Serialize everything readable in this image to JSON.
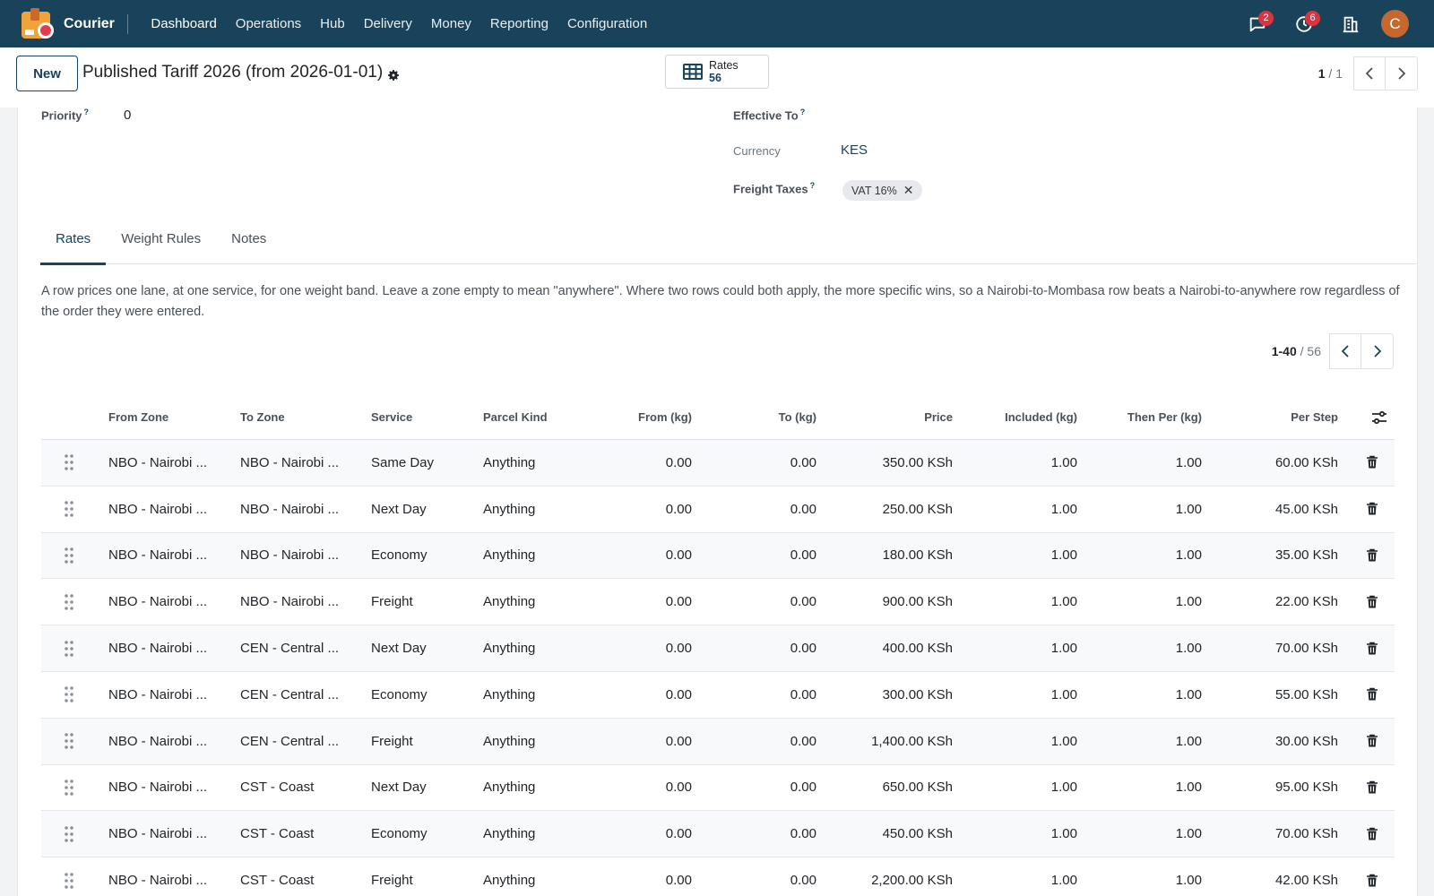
{
  "navbar": {
    "brand": "Courier",
    "menu": [
      "Dashboard",
      "Operations",
      "Hub",
      "Delivery",
      "Money",
      "Reporting",
      "Configuration"
    ],
    "messages_badge": "2",
    "activities_badge": "6",
    "avatar_initial": "C",
    "avatar_color": "#c6672d",
    "bar_color": "#18435a"
  },
  "control": {
    "new_label": "New",
    "title": "Published Tariff 2026 (from 2026-01-01)",
    "smart_button": {
      "label": "Rates",
      "count": "56",
      "icon": "table-icon"
    },
    "pager": {
      "current": "1",
      "total": "/ 1"
    }
  },
  "fields": {
    "priority": {
      "label": "Priority",
      "help": "?",
      "value": "0"
    },
    "effective_to": {
      "label": "Effective To",
      "help": "?"
    },
    "currency": {
      "label": "Currency",
      "value": "KES"
    },
    "freight_taxes": {
      "label": "Freight Taxes",
      "help": "?",
      "tag": "VAT 16%"
    }
  },
  "tabs": [
    "Rates",
    "Weight Rules",
    "Notes"
  ],
  "helptext": "A row prices one lane, at one service, for one weight band. Leave a zone empty to mean \"anywhere\". Where two rows could both apply, the more specific wins, so a Nairobi-to-Mombasa row beats a Nairobi-to-anywhere row regardless of the order they were entered.",
  "list_pager": {
    "range": "1-40",
    "total": "/ 56"
  },
  "table": {
    "columns": [
      "From Zone",
      "To Zone",
      "Service",
      "Parcel Kind",
      "From (kg)",
      "To (kg)",
      "Price",
      "Included (kg)",
      "Then Per (kg)",
      "Per Step"
    ],
    "rows": [
      [
        "NBO - Nairobi ...",
        "NBO - Nairobi ...",
        "Same Day",
        "Anything",
        "0.00",
        "0.00",
        "350.00 KSh",
        "1.00",
        "1.00",
        "60.00 KSh"
      ],
      [
        "NBO - Nairobi ...",
        "NBO - Nairobi ...",
        "Next Day",
        "Anything",
        "0.00",
        "0.00",
        "250.00 KSh",
        "1.00",
        "1.00",
        "45.00 KSh"
      ],
      [
        "NBO - Nairobi ...",
        "NBO - Nairobi ...",
        "Economy",
        "Anything",
        "0.00",
        "0.00",
        "180.00 KSh",
        "1.00",
        "1.00",
        "35.00 KSh"
      ],
      [
        "NBO - Nairobi ...",
        "NBO - Nairobi ...",
        "Freight",
        "Anything",
        "0.00",
        "0.00",
        "900.00 KSh",
        "1.00",
        "1.00",
        "22.00 KSh"
      ],
      [
        "NBO - Nairobi ...",
        "CEN - Central ...",
        "Next Day",
        "Anything",
        "0.00",
        "0.00",
        "400.00 KSh",
        "1.00",
        "1.00",
        "70.00 KSh"
      ],
      [
        "NBO - Nairobi ...",
        "CEN - Central ...",
        "Economy",
        "Anything",
        "0.00",
        "0.00",
        "300.00 KSh",
        "1.00",
        "1.00",
        "55.00 KSh"
      ],
      [
        "NBO - Nairobi ...",
        "CEN - Central ...",
        "Freight",
        "Anything",
        "0.00",
        "0.00",
        "1,400.00 KSh",
        "1.00",
        "1.00",
        "30.00 KSh"
      ],
      [
        "NBO - Nairobi ...",
        "CST - Coast",
        "Next Day",
        "Anything",
        "0.00",
        "0.00",
        "650.00 KSh",
        "1.00",
        "1.00",
        "95.00 KSh"
      ],
      [
        "NBO - Nairobi ...",
        "CST - Coast",
        "Economy",
        "Anything",
        "0.00",
        "0.00",
        "450.00 KSh",
        "1.00",
        "1.00",
        "70.00 KSh"
      ],
      [
        "NBO - Nairobi ...",
        "CST - Coast",
        "Freight",
        "Anything",
        "0.00",
        "0.00",
        "2,200.00 KSh",
        "1.00",
        "1.00",
        "42.00 KSh"
      ]
    ]
  }
}
